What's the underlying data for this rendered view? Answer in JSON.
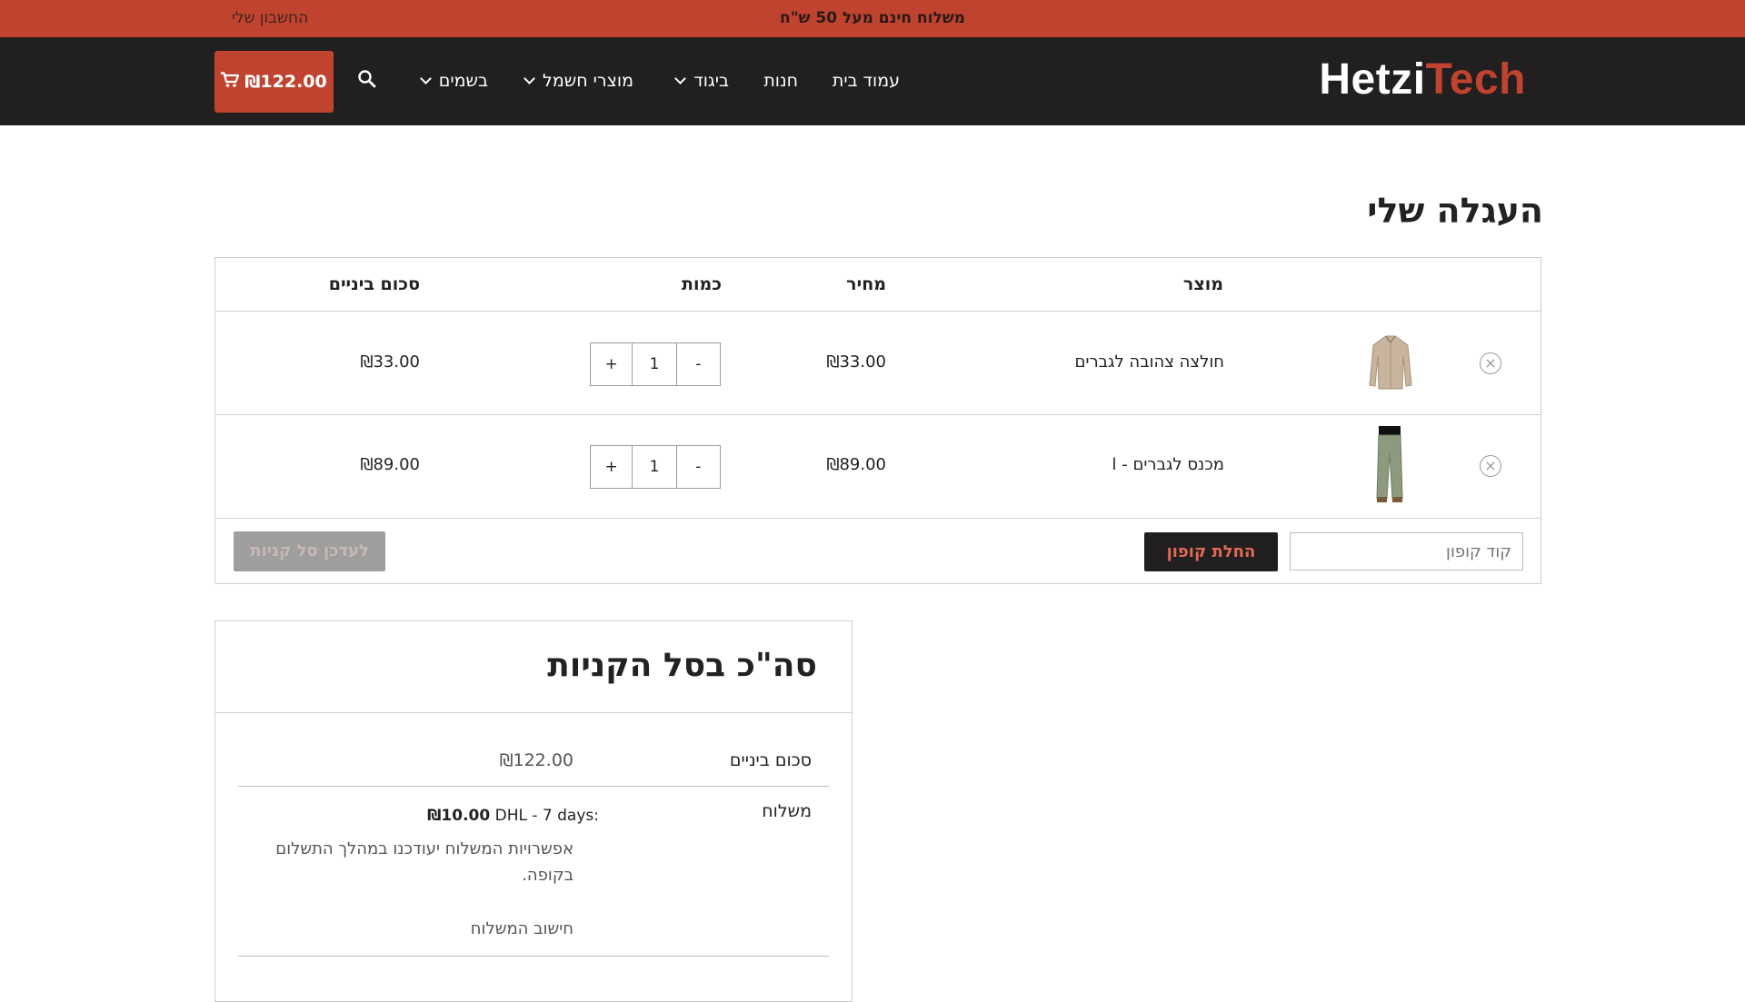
{
  "topbar": {
    "promo": "משלוח חינם מעל 50 ש\"ח",
    "account": "החשבון שלי",
    "bg_color": "#c0432f"
  },
  "nav": {
    "logo_part1": "Hetzi",
    "logo_part2": "Tech",
    "items": [
      {
        "label": "עמוד בית",
        "has_dropdown": false
      },
      {
        "label": "חנות",
        "has_dropdown": false
      },
      {
        "label": "ביגוד",
        "has_dropdown": true
      },
      {
        "label": "מוצרי חשמל",
        "has_dropdown": true
      },
      {
        "label": "בשמים",
        "has_dropdown": true
      }
    ],
    "search_icon": "search-icon",
    "cart_total": "₪122.00",
    "cart_icon": "cart-icon"
  },
  "page": {
    "title": "העגלה שלי"
  },
  "cart": {
    "headers": {
      "product": "מוצר",
      "price": "מחיר",
      "quantity": "כמות",
      "subtotal": "סכום ביניים"
    },
    "items": [
      {
        "name": "חולצה צהובה לגברים",
        "price": "₪33.00",
        "quantity": "1",
        "subtotal": "₪33.00",
        "minus": "-",
        "plus": "+",
        "remove": "×"
      },
      {
        "name": "מכנס לגברים - l",
        "price": "₪89.00",
        "quantity": "1",
        "subtotal": "₪89.00",
        "minus": "-",
        "plus": "+",
        "remove": "×"
      }
    ],
    "coupon_placeholder": "קוד קופון",
    "apply_coupon": "החלת קופון",
    "update_cart": "לעדכן סל קניות"
  },
  "totals": {
    "title": "סה\"כ בסל הקניות",
    "subtotal_label": "סכום ביניים",
    "subtotal_value": "₪122.00",
    "shipping_label": "משלוח",
    "shipping_method": "DHL - 7 days:",
    "shipping_price": "₪10.00",
    "shipping_note": "אפשרויות המשלוח יעודכנו במהלך התשלום בקופה.",
    "calc_shipping": "חישוב המשלוח"
  }
}
